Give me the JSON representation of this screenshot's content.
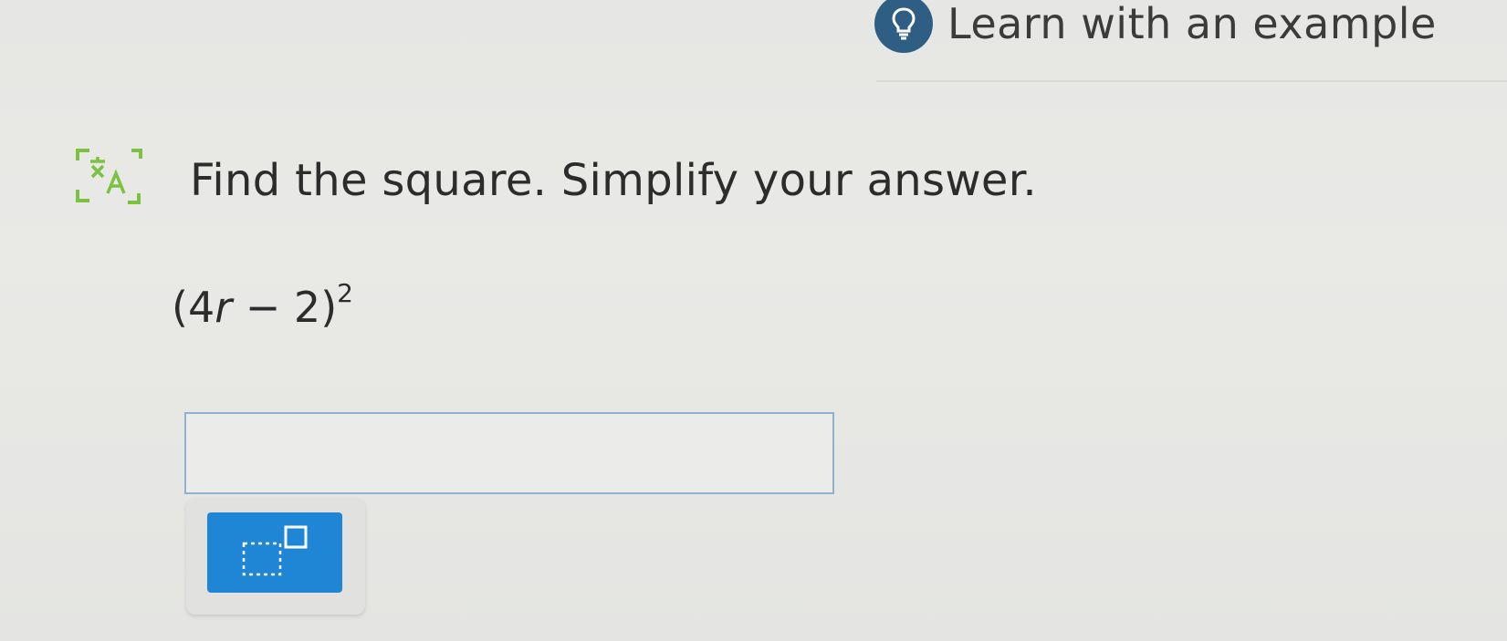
{
  "header": {
    "learn_label": "Learn with an example",
    "learn_icon": "lightbulb-icon"
  },
  "question": {
    "translate_icon": "translate-icon",
    "prompt": "Find the square. Simplify your answer.",
    "expression": {
      "open": "(4",
      "variable": "r",
      "rest": " − 2)",
      "exponent": "2"
    }
  },
  "answer": {
    "value": "",
    "placeholder": ""
  },
  "toolbar": {
    "exponent_button_icon": "exponent-template-icon"
  },
  "colors": {
    "accent": "#1f86d6",
    "badge": "#2f5e85",
    "translate_icon": "#7cc242",
    "input_border": "#8fb3cf"
  }
}
